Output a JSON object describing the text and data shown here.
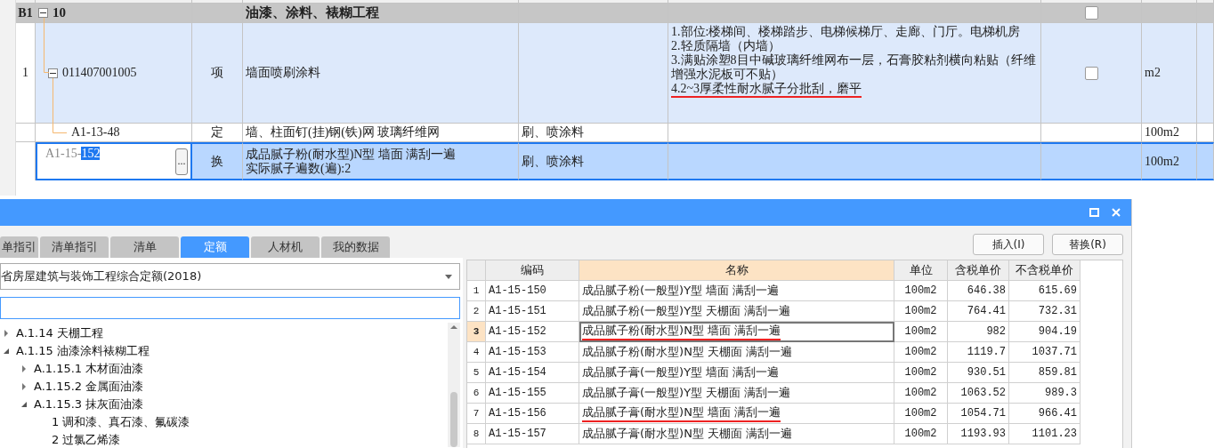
{
  "grid": {
    "rows": [
      {
        "kind": "group",
        "number": "B1",
        "code": "10",
        "expanded": true,
        "name": "油漆、涂料、裱糊工程",
        "checked": false
      },
      {
        "kind": "item",
        "number": "1",
        "code": "011407001005",
        "expanded": true,
        "type": "项",
        "name": "墙面喷刷涂料",
        "description": [
          {
            "text": "1.部位:楼梯间、楼梯踏步、电梯候梯厅、走廊、门厅。电梯机房",
            "underlined": false
          },
          {
            "text": "2.轻质隔墙（内墙）",
            "underlined": false
          },
          {
            "text": "3.满贴涂塑8目中碱玻璃纤维网布一层，石膏胶粘剂横向粘贴（纤维增强水泥板可不贴）",
            "underlined": false
          },
          {
            "text": "4.2~3厚柔性耐水腻子分批刮，磨平",
            "underlined": true
          }
        ],
        "checked": false,
        "unit": "m2"
      },
      {
        "kind": "quota",
        "code": "A1-13-48",
        "type": "定",
        "name": "墙、柱面钉(挂)钢(铁)网 玻璃纤维网",
        "feature": "刷、喷涂料",
        "unit": "100m2"
      },
      {
        "kind": "editing",
        "code_prefix": "A1-15-",
        "code_selected": "152",
        "ellipsis": "...",
        "type": "换",
        "name_lines": [
          "成品腻子粉(耐水型)N型 墙面 满刮一遍",
          "实际腻子遍数(遍):2"
        ],
        "feature": "刷、喷涂料",
        "unit": "100m2"
      }
    ]
  },
  "dialog": {
    "tabs": [
      {
        "label": "单指引",
        "selected": false
      },
      {
        "label": "清单指引",
        "selected": false
      },
      {
        "label": "清单",
        "selected": false
      },
      {
        "label": "定额",
        "selected": true
      },
      {
        "label": "人材机",
        "selected": false
      },
      {
        "label": "我的数据",
        "selected": false
      }
    ],
    "library": "省房屋建筑与装饰工程综合定额(2018)",
    "tree": [
      {
        "label": "A.1.14 天棚工程",
        "expanded": false
      },
      {
        "label": "A.1.15 油漆涂料裱糊工程",
        "expanded": true,
        "children": [
          {
            "label": "A.1.15.1 木材面油漆",
            "expanded": false
          },
          {
            "label": "A.1.15.2 金属面油漆",
            "expanded": false
          },
          {
            "label": "A.1.15.3 抹灰面油漆",
            "expanded": true,
            "children": [
              {
                "label": "1 调和漆、真石漆、氟碳漆"
              },
              {
                "label": "2 过氯乙烯漆"
              }
            ]
          }
        ]
      }
    ],
    "buttons": [
      "插入(I)",
      "替换(R)"
    ],
    "table": {
      "columns": [
        {
          "label": "编码",
          "selected": false
        },
        {
          "label": "名称",
          "selected": true
        },
        {
          "label": "单位",
          "selected": false
        },
        {
          "label": "含税单价",
          "selected": false
        },
        {
          "label": "不含税单价",
          "selected": false
        }
      ],
      "rows": [
        {
          "number": "1",
          "code": "A1-15-150",
          "name": "成品腻子粉(一般型)Y型 墙面 满刮一遍",
          "unit": "100m2",
          "price_tax": "646.38",
          "price": "615.69",
          "selected": false,
          "underlined": false
        },
        {
          "number": "2",
          "code": "A1-15-151",
          "name": "成品腻子粉(一般型)Y型 天棚面 满刮一遍",
          "unit": "100m2",
          "price_tax": "764.41",
          "price": "732.31",
          "selected": false,
          "underlined": false
        },
        {
          "number": "3",
          "code": "A1-15-152",
          "name": "成品腻子粉(耐水型)N型 墙面 满刮一遍",
          "unit": "100m2",
          "price_tax": "982",
          "price": "904.19",
          "selected": true,
          "underlined": true
        },
        {
          "number": "4",
          "code": "A1-15-153",
          "name": "成品腻子粉(耐水型)N型 天棚面 满刮一遍",
          "unit": "100m2",
          "price_tax": "1119.7",
          "price": "1037.71",
          "selected": false,
          "underlined": false
        },
        {
          "number": "5",
          "code": "A1-15-154",
          "name": "成品腻子膏(一般型)Y型 墙面 满刮一遍",
          "unit": "100m2",
          "price_tax": "930.51",
          "price": "859.81",
          "selected": false,
          "underlined": false
        },
        {
          "number": "6",
          "code": "A1-15-155",
          "name": "成品腻子膏(一般型)Y型 天棚面 满刮一遍",
          "unit": "100m2",
          "price_tax": "1063.52",
          "price": "989.3",
          "selected": false,
          "underlined": false
        },
        {
          "number": "7",
          "code": "A1-15-156",
          "name": "成品腻子膏(耐水型)N型 墙面 满刮一遍",
          "unit": "100m2",
          "price_tax": "1054.71",
          "price": "966.41",
          "selected": false,
          "underlined": true
        },
        {
          "number": "8",
          "code": "A1-15-157",
          "name": "成品腻子膏(耐水型)N型 天棚面 满刮一遍",
          "unit": "100m2",
          "price_tax": "1193.93",
          "price": "1101.23",
          "selected": false,
          "underlined": false
        }
      ]
    }
  }
}
